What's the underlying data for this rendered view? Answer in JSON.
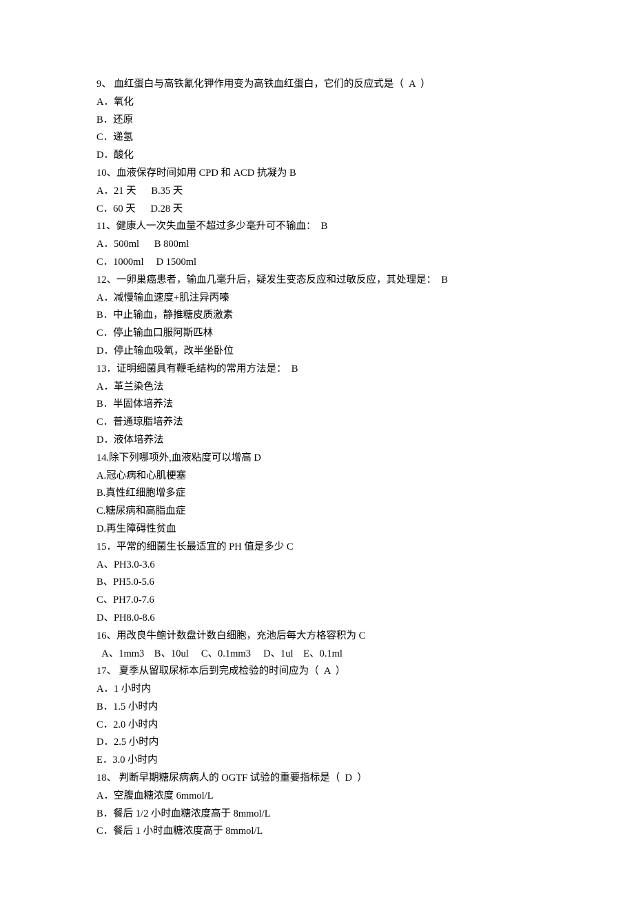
{
  "lines": [
    "9、 血红蛋白与高铁氰化钾作用变为高铁血红蛋白，它们的反应式是（  A  ）",
    "A．氧化",
    "B．还原",
    "C．递氢",
    "D．酸化",
    "10、血液保存时间如用 CPD 和 ACD 抗凝为 B",
    "A．21 天      B.35 天",
    "C．60 天      D.28 天",
    "11、健康人一次失血量不超过多少毫升可不输血：  B",
    "A．500ml      B 800ml",
    "C．1000ml     D 1500ml",
    "12、一卵巢癌患者，输血几毫升后，疑发生变态反应和过敏反应，其处理是：  B",
    "A．减慢输血速度+肌注异丙嗪",
    "B．中止输血，静推糖皮质激素",
    "C．停止输血口服阿斯匹林",
    "D．停止输血吸氧，改半坐卧位",
    "13．证明细菌具有鞭毛结构的常用方法是：  B",
    "A．革兰染色法",
    "B．半固体培养法",
    "C．普通琼脂培养法",
    "D．液体培养法",
    "14.除下列哪项外,血液粘度可以增高 D",
    "A.冠心病和心肌梗塞",
    "B.真性红细胞增多症",
    "C.糖尿病和高脂血症",
    "D.再生障碍性贫血",
    "15．平常的细菌生长最适宜的 PH 值是多少 C",
    "A、PH3.0-3.6",
    "B、PH5.0-5.6",
    "C、PH7.0-7.6",
    "D、PH8.0-8.6",
    "",
    "16、用改良牛鲍计数盘计数白细胞，充池后每大方格容积为 C",
    "  A、1mm3    B、10ul     C、0.1mm3     D、1ul    E、0.1ml",
    "17、 夏季从留取尿标本后到完成检验的时间应为（  A  ）",
    "A．1 小时内",
    "B．1.5 小时内",
    "C．2.0 小时内",
    "D．2.5 小时内",
    "E．3.0 小时内",
    "18、 判断早期糖尿病病人的 OGTF 试验的重要指标是（  D  ）",
    "A．空腹血糖浓度 6mmol/L",
    "B．餐后 1/2 小时血糖浓度高于 8mmol/L",
    "C．餐后 1 小时血糖浓度高于 8mmol/L"
  ]
}
